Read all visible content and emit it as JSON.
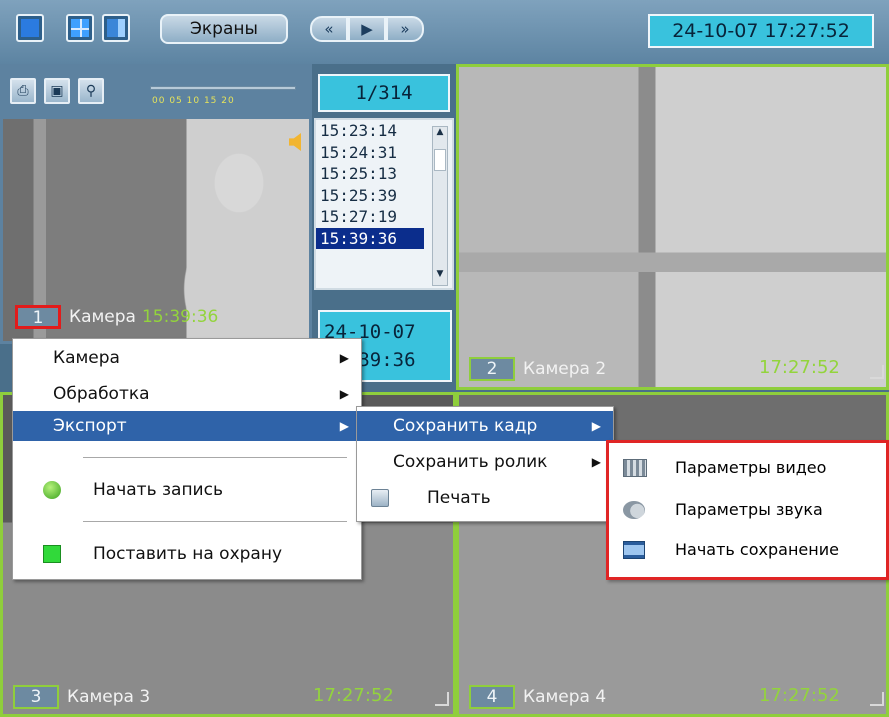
{
  "toolbar": {
    "screens_label": "Экраны",
    "nav": [
      "«",
      "▶",
      "»"
    ],
    "datetime": "24-10-07  17:27:52"
  },
  "archive": {
    "counter": "1/314",
    "slider_ticks": "00 05 10  15  20",
    "times": [
      "15:23:14",
      "15:24:31",
      "15:25:13",
      "15:25:39",
      "15:27:19",
      "15:39:36"
    ],
    "selected_time": "15:39:36",
    "date_line1": "24-10-07",
    "date_line2": "15:39:36"
  },
  "cameras": [
    {
      "num": "1",
      "name": "Камера",
      "time": "15:39:36"
    },
    {
      "num": "2",
      "name": "Камера 2",
      "time": "17:27:52"
    },
    {
      "num": "3",
      "name": "Камера 3",
      "time": "17:27:52"
    },
    {
      "num": "4",
      "name": "Камера 4",
      "time": "17:27:52"
    }
  ],
  "context_menu": {
    "items": [
      "Камера",
      "Обработка",
      "Экспорт",
      "Начать запись",
      "Поставить на охрану"
    ]
  },
  "export_menu": {
    "items": [
      "Сохранить кадр",
      "Сохранить ролик",
      "Печать"
    ]
  },
  "frame_menu": {
    "items": [
      "Параметры видео",
      "Параметры звука",
      "Начать сохранение"
    ]
  },
  "colors": {
    "accent": "#39c2dd",
    "highlight": "#2f63a9",
    "tile_border": "#8fce3c",
    "selection_red": "#e21b1b"
  }
}
